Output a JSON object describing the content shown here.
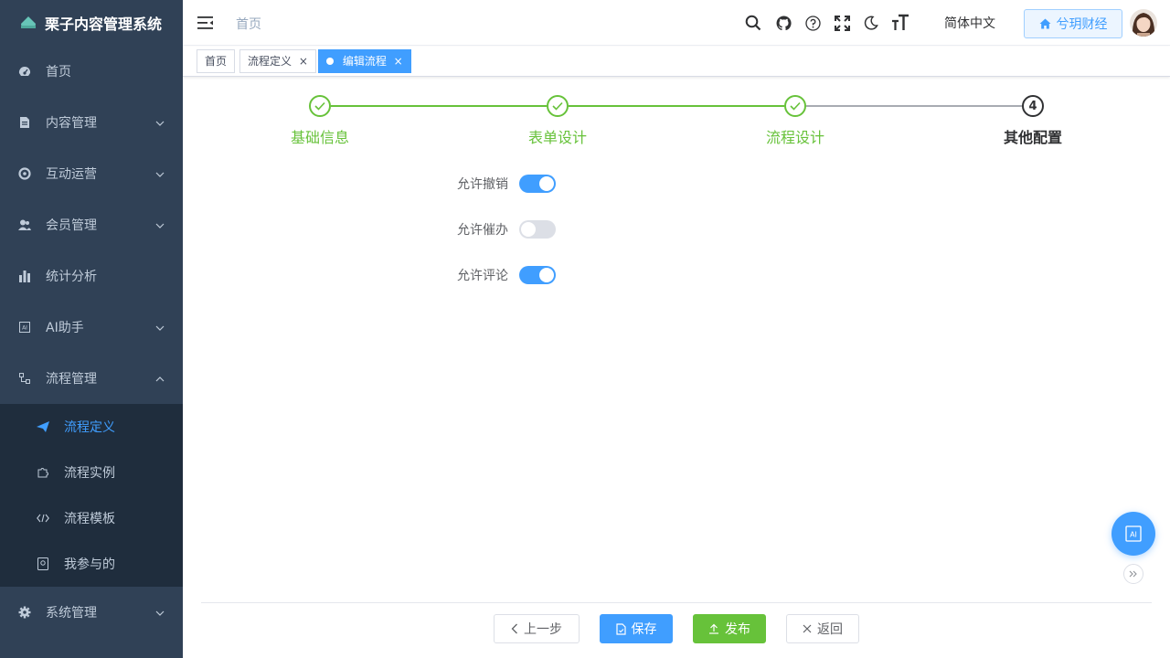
{
  "app": {
    "title": "栗子内容管理系统"
  },
  "sidebar": {
    "items": [
      {
        "label": "首页",
        "icon": "dashboard-icon"
      },
      {
        "label": "内容管理",
        "icon": "document-icon"
      },
      {
        "label": "互动运营",
        "icon": "lifebuoy-icon"
      },
      {
        "label": "会员管理",
        "icon": "users-icon"
      },
      {
        "label": "统计分析",
        "icon": "bar-chart-icon"
      },
      {
        "label": "AI助手",
        "icon": "ai-icon"
      },
      {
        "label": "流程管理",
        "icon": "flow-icon"
      },
      {
        "label": "系统管理",
        "icon": "gear-icon"
      }
    ],
    "flow_sub": [
      {
        "label": "流程定义",
        "icon": "send-icon",
        "active": true
      },
      {
        "label": "流程实例",
        "icon": "puzzle-icon"
      },
      {
        "label": "流程模板",
        "icon": "code-icon"
      },
      {
        "label": "我参与的",
        "icon": "badge-icon"
      }
    ]
  },
  "header": {
    "breadcrumb": "首页",
    "language": "简体中文",
    "tenant": "兮玥财经"
  },
  "tags": [
    {
      "label": "首页"
    },
    {
      "label": "流程定义",
      "close": "×"
    },
    {
      "label": "编辑流程",
      "close": "×",
      "active": true
    }
  ],
  "steps": [
    {
      "title": "基础信息",
      "status": "done"
    },
    {
      "title": "表单设计",
      "status": "done"
    },
    {
      "title": "流程设计",
      "status": "done"
    },
    {
      "title": "其他配置",
      "status": "current",
      "number": "4"
    }
  ],
  "form": {
    "fields": [
      {
        "label": "允许撤销",
        "on": true
      },
      {
        "label": "允许催办",
        "on": false
      },
      {
        "label": "允许评论",
        "on": true
      }
    ]
  },
  "footer": {
    "prev": "上一步",
    "save": "保存",
    "publish": "发布",
    "back": "返回"
  },
  "colors": {
    "sidebar_bg": "#304156",
    "submenu_bg": "#1f2d3d",
    "primary": "#409eff",
    "success": "#67c23a"
  }
}
